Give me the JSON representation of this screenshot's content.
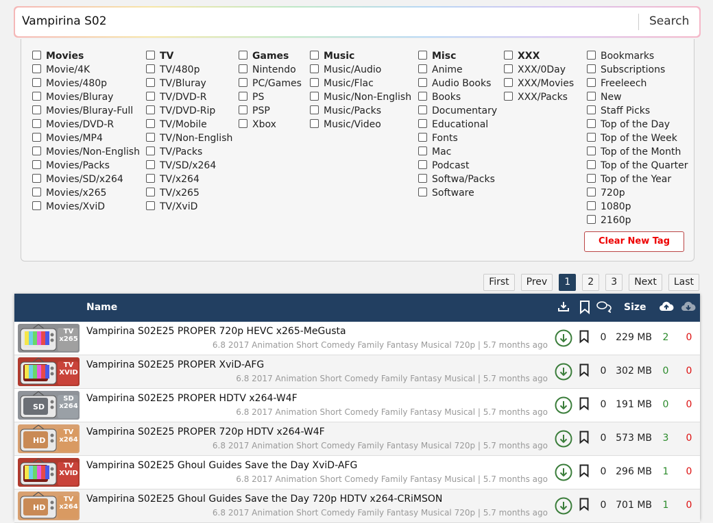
{
  "search": {
    "query": "Vampirina S02",
    "button_label": "Search"
  },
  "filters": {
    "columns": [
      {
        "heading": "Movies",
        "items": [
          "Movie/4K",
          "Movies/480p",
          "Movies/Bluray",
          "Movies/Bluray-Full",
          "Movies/DVD-R",
          "Movies/MP4",
          "Movies/Non-English",
          "Movies/Packs",
          "Movies/SD/x264",
          "Movies/x265",
          "Movies/XviD"
        ]
      },
      {
        "heading": "TV",
        "items": [
          "TV/480p",
          "TV/Bluray",
          "TV/DVD-R",
          "TV/DVD-Rip",
          "TV/Mobile",
          "TV/Non-English",
          "TV/Packs",
          "TV/SD/x264",
          "TV/x264",
          "TV/x265",
          "TV/XviD"
        ]
      },
      {
        "heading": "Games",
        "items": [
          "Nintendo",
          "PC/Games",
          "PS",
          "PSP",
          "Xbox"
        ]
      },
      {
        "heading": "Music",
        "items": [
          "Music/Audio",
          "Music/Flac",
          "Music/Non-English",
          "Music/Packs",
          "Music/Video"
        ]
      },
      {
        "heading": "Misc",
        "items": [
          "Anime",
          "Audio Books",
          "Books",
          "Documentary",
          "Educational",
          "Fonts",
          "Mac",
          "Podcast",
          "Softwa/Packs",
          "Software"
        ]
      },
      {
        "heading": "XXX",
        "items": [
          "XXX/0Day",
          "XXX/Movies",
          "XXX/Packs"
        ]
      },
      {
        "heading": "",
        "items": [
          "Bookmarks",
          "Subscriptions",
          "Freeleech",
          "New",
          "Staff Picks",
          "Top of the Day",
          "Top of the Week",
          "Top of the Month",
          "Top of the Quarter",
          "Top of the Year",
          "720p",
          "1080p",
          "2160p"
        ]
      }
    ],
    "clear_button": "Clear New Tag"
  },
  "pagination": [
    "First",
    "Prev",
    "1",
    "2",
    "3",
    "Next",
    "Last"
  ],
  "pagination_active": "1",
  "table": {
    "headers": {
      "name": "Name",
      "size": "Size"
    },
    "header_icons": [
      "download-count-icon",
      "bookmark-icon",
      "comments-icon",
      "seeders-icon",
      "leechers-icon"
    ],
    "rows": [
      {
        "thumb": "tv-x265",
        "thumb_label": "TV\nx265",
        "name": "Vampirina S02E25 PROPER 720p HEVC x265-MeGusta",
        "meta": "6.8 2017 Animation Short Comedy Family Fantasy Musical 720p | 5.7 months ago",
        "comments": "0",
        "size": "229 MB",
        "seeders": "2",
        "leechers": "0"
      },
      {
        "thumb": "tv-xvid",
        "thumb_label": "TV\nXVID",
        "name": "Vampirina S02E25 PROPER XviD-AFG",
        "meta": "6.8 2017 Animation Short Comedy Family Fantasy Musical | 5.7 months ago",
        "comments": "0",
        "size": "302 MB",
        "seeders": "0",
        "leechers": "0"
      },
      {
        "thumb": "sd-x264",
        "thumb_label": "SD\nx264",
        "name": "Vampirina S02E25 PROPER HDTV x264-W4F",
        "meta": "6.8 2017 Animation Short Comedy Family Fantasy Musical | 5.7 months ago",
        "comments": "0",
        "size": "191 MB",
        "seeders": "0",
        "leechers": "0"
      },
      {
        "thumb": "hd-x264",
        "thumb_label": "TV\nx264",
        "name": "Vampirina S02E25 PROPER 720p HDTV x264-W4F",
        "meta": "6.8 2017 Animation Short Comedy Family Fantasy Musical 720p | 5.7 months ago",
        "comments": "0",
        "size": "573 MB",
        "seeders": "3",
        "leechers": "0"
      },
      {
        "thumb": "tv-xvid",
        "thumb_label": "TV\nXVID",
        "name": "Vampirina S02E25 Ghoul Guides Save the Day XviD-AFG",
        "meta": "6.8 2017 Animation Short Comedy Family Fantasy Musical | 5.7 months ago",
        "comments": "0",
        "size": "296 MB",
        "seeders": "1",
        "leechers": "0"
      },
      {
        "thumb": "hd-x264",
        "thumb_label": "TV\nx264",
        "name": "Vampirina S02E25 Ghoul Guides Save the Day 720p HDTV x264-CRiMSON",
        "meta": "6.8 2017 Animation Short Comedy Family Fantasy Musical 720p | 5.7 months ago",
        "comments": "0",
        "size": "701 MB",
        "seeders": "1",
        "leechers": "0"
      }
    ]
  },
  "colors": {
    "header_bg": "#223f61",
    "seed": "#2a8a2a",
    "leech": "#dd1111",
    "download_icon": "#3a7d3a",
    "clear_tag": "#ee0000"
  }
}
